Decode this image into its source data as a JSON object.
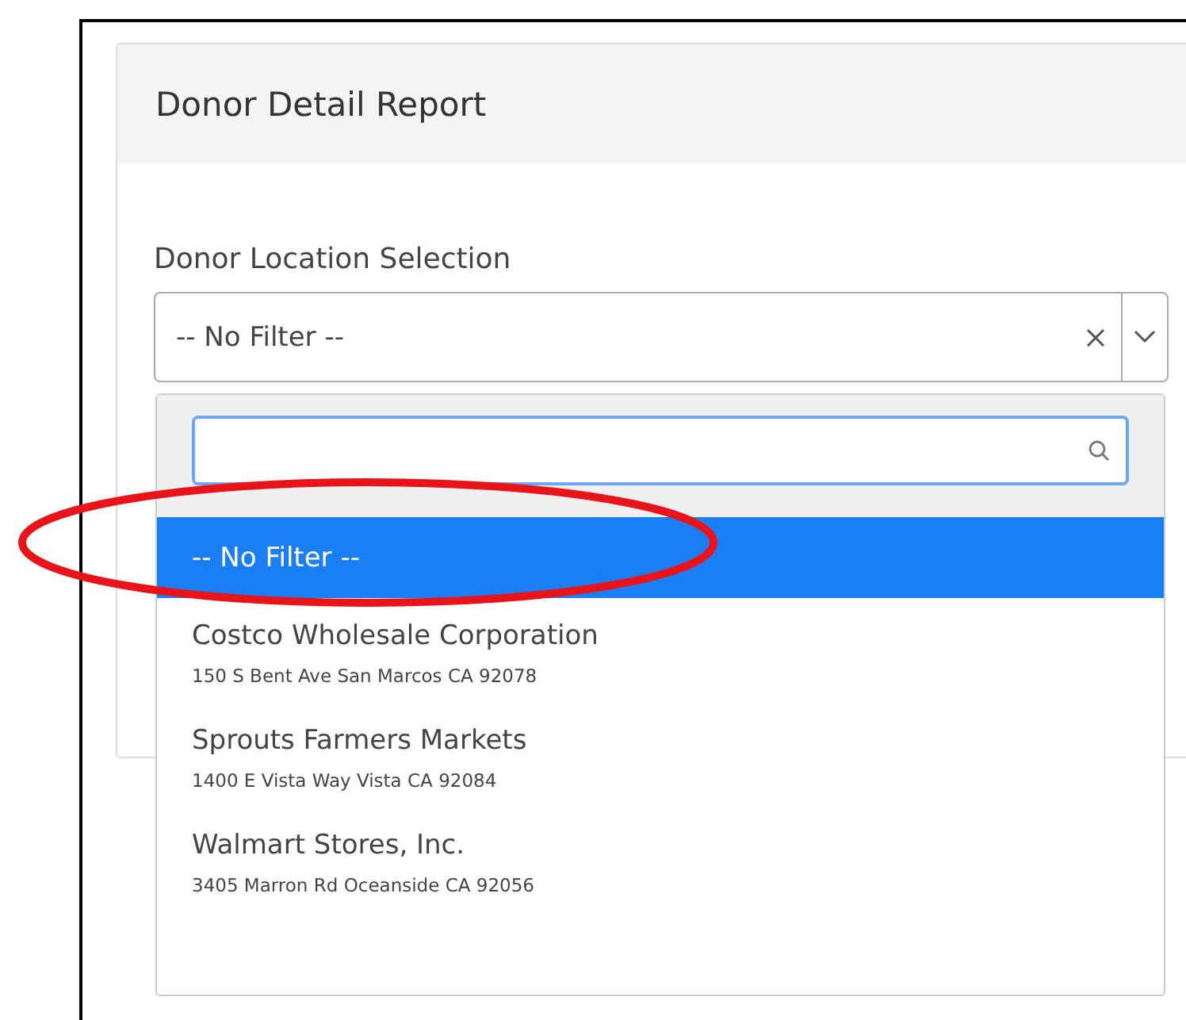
{
  "panel": {
    "title": "Donor Detail Report"
  },
  "field": {
    "label": "Donor Location Selection",
    "value": "-- No Filter --"
  },
  "dropdown": {
    "options": [
      {
        "name": "-- No Filter --",
        "selected": true
      },
      {
        "name": "Costco Wholesale Corporation",
        "address": "150 S Bent Ave San Marcos CA 92078",
        "selected": false
      },
      {
        "name": "Sprouts Farmers Markets",
        "address": "1400 E Vista Way Vista CA 92084",
        "selected": false
      },
      {
        "name": "Walmart Stores, Inc.",
        "address": "3405 Marron Rd Oceanside CA 92056",
        "selected": false
      }
    ]
  }
}
